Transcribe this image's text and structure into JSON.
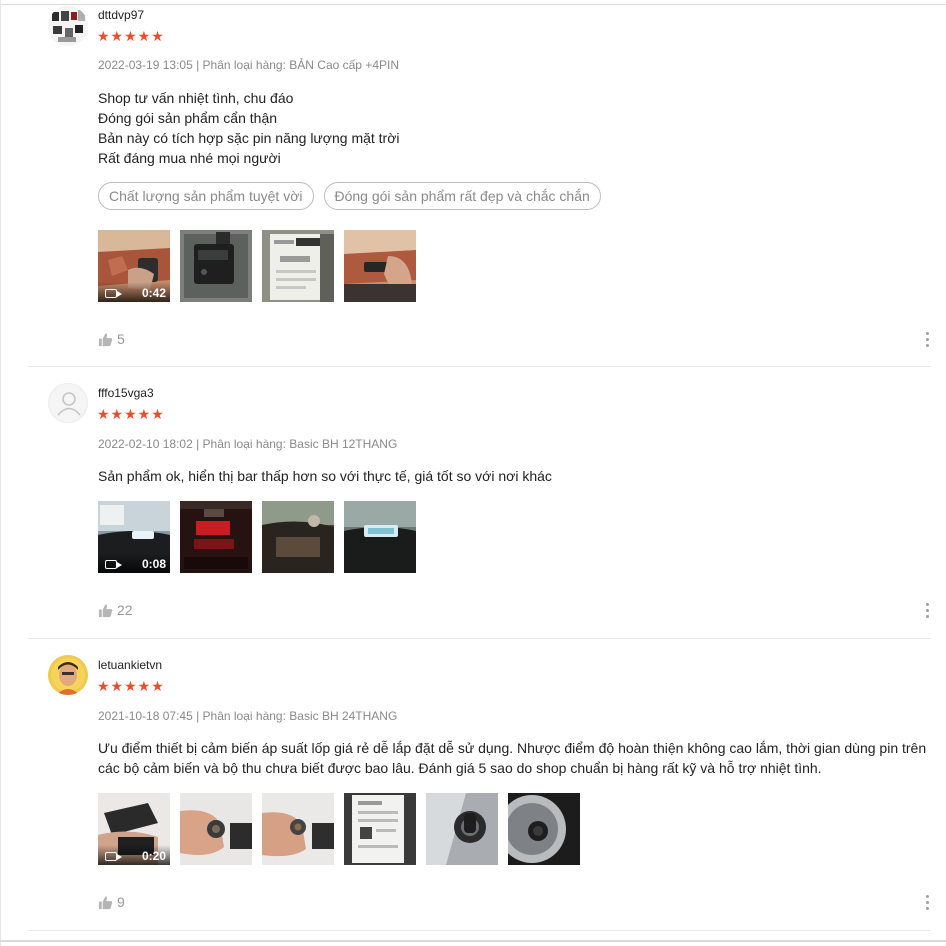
{
  "colors": {
    "star": "#ee4d2d",
    "meta": "#8a8a8a",
    "tag_border": "#bdbdbd"
  },
  "reviews": [
    {
      "username": "dttdvp97",
      "stars": "★★★★★",
      "rating": 5,
      "meta": "2022-03-19 13:05 | Phân loại hàng: BẢN Cao cấp +4PIN",
      "text_lines": [
        "Shop tư vấn nhiệt tình, chu đáo",
        "Đóng gói sản phẩm cẩn thận",
        "Bản này có tích hợp sặc pin năng lượng mặt trời",
        "Rất đáng mua nhé mọi người"
      ],
      "tags": [
        "Chất lượng sản phẩm tuyệt vời",
        "Đóng gói sản phẩm rất đẹp và chắc chắn"
      ],
      "video_duration": "0:42",
      "likes": "5"
    },
    {
      "username": "fffo15vga3",
      "stars": "★★★★★",
      "rating": 5,
      "meta": "2022-02-10 18:02 | Phân loại hàng: Basic BH 12THANG",
      "text_lines": [
        "Sản phẩm ok, hiển thị bar thấp hơn so với thực tế, giá tốt so với nơi khác"
      ],
      "video_duration": "0:08",
      "likes": "22"
    },
    {
      "username": "letuankietvn",
      "stars": "★★★★★",
      "rating": 5,
      "meta": "2021-10-18 07:45 | Phân loại hàng: Basic BH 24THANG",
      "text_lines": [
        "Ưu điểm thiết bị cảm biến áp suất lốp giá rẻ dễ lắp đặt dễ sử dụng. Nhược điểm độ hoàn thiện không cao lắm, thời gian dùng pin trên",
        "các bộ cảm biến và bộ thu chưa biết được bao lâu. Đánh giá 5 sao do shop chuẩn bị hàng rất kỹ và hỗ trợ nhiệt tình."
      ],
      "video_duration": "0:20",
      "likes": "9"
    }
  ]
}
